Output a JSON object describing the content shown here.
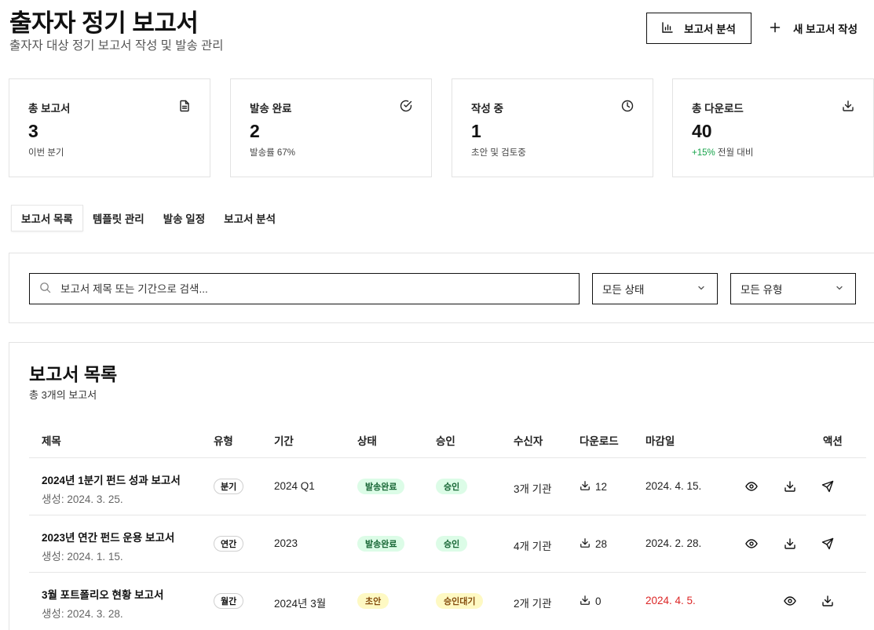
{
  "header": {
    "title": "출자자 정기 보고서",
    "subtitle": "출자자 대상 정기 보고서 작성 및 발송 관리",
    "analysis_button": "보고서 분석",
    "new_button": "새 보고서 작성"
  },
  "stats": [
    {
      "label": "총 보고서",
      "value": "3",
      "sub": "이번 분기",
      "icon": "document-icon"
    },
    {
      "label": "발송 완료",
      "value": "2",
      "sub": "발송률 67%",
      "icon": "check-circle-icon"
    },
    {
      "label": "작성 중",
      "value": "1",
      "sub": "초안 및 검토중",
      "icon": "clock-icon"
    },
    {
      "label": "총 다운로드",
      "value": "40",
      "sub_highlight": "+15%",
      "sub": " 전월 대비",
      "icon": "download-icon"
    }
  ],
  "tabs": [
    "보고서 목록",
    "템플릿 관리",
    "발송 일정",
    "보고서 분석"
  ],
  "active_tab": "보고서 목록",
  "filters": {
    "search_placeholder": "보고서 제목 또는 기간으로 검색...",
    "status_select": "모든 상태",
    "type_select": "모든 유형"
  },
  "list": {
    "title": "보고서 목록",
    "count_text": "총 3개의 보고서",
    "columns": [
      "제목",
      "유형",
      "기간",
      "상태",
      "승인",
      "수신자",
      "다운로드",
      "마감일",
      "액션"
    ],
    "rows": [
      {
        "title": "2024년 1분기 펀드 성과 보고서",
        "created": "생성: 2024. 3. 25.",
        "type": "분기",
        "period": "2024 Q1",
        "status": "발송완료",
        "approval": "승인",
        "recipients": "3개 기관",
        "downloads": "12",
        "due": "2024. 4. 15.",
        "due_overdue": false,
        "actions": [
          "view",
          "download",
          "send"
        ]
      },
      {
        "title": "2023년 연간 펀드 운용 보고서",
        "created": "생성: 2024. 1. 15.",
        "type": "연간",
        "period": "2023",
        "status": "발송완료",
        "approval": "승인",
        "recipients": "4개 기관",
        "downloads": "28",
        "due": "2024. 2. 28.",
        "due_overdue": false,
        "actions": [
          "view",
          "download",
          "send"
        ]
      },
      {
        "title": "3월 포트폴리오 현황 보고서",
        "created": "생성: 2024. 3. 28.",
        "type": "월간",
        "period": "2024년 3월",
        "status": "초안",
        "approval": "승인대기",
        "recipients": "2개 기관",
        "downloads": "0",
        "due": "2024. 4. 5.",
        "due_overdue": true,
        "actions": [
          "view",
          "download"
        ]
      }
    ]
  },
  "colors": {
    "sent_bg": "#dcfce7",
    "sent_fg": "#166534",
    "draft_bg": "#fef9c3",
    "draft_fg": "#854d0e",
    "overdue": "#dc2626",
    "positive": "#16a34a"
  }
}
